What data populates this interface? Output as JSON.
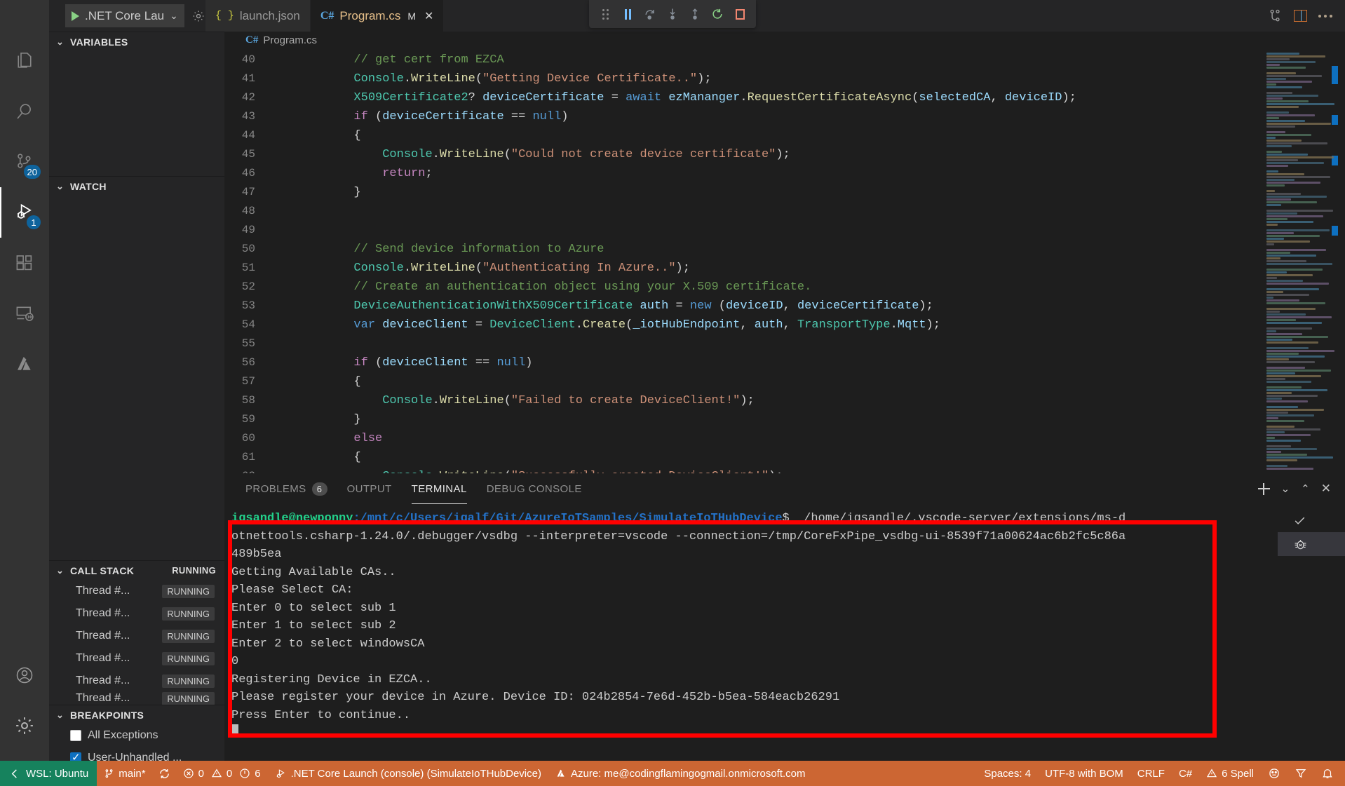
{
  "window": {
    "debug_config": ".NET Core Lau",
    "gear_icon": "gear-icon",
    "more_actions_icon": "ellipsis-icon"
  },
  "tabs": [
    {
      "label": "launch.json",
      "icon": "json-braces-icon",
      "active": false,
      "dirty": "",
      "closable": false
    },
    {
      "label": "Program.cs",
      "icon": "csharp-icon",
      "active": true,
      "dirty": "M",
      "closable": true
    }
  ],
  "debug_toolbar": {
    "buttons": [
      {
        "name": "drag-handle",
        "label": "Drag"
      },
      {
        "name": "pause-button",
        "label": "Pause"
      },
      {
        "name": "step-over-button",
        "label": "Step Over"
      },
      {
        "name": "step-into-button",
        "label": "Step Into"
      },
      {
        "name": "step-out-button",
        "label": "Step Out"
      },
      {
        "name": "restart-button",
        "label": "Restart"
      },
      {
        "name": "stop-button",
        "label": "Stop"
      }
    ]
  },
  "activity_bar": {
    "items": [
      {
        "name": "explorer",
        "icon": "files-icon",
        "badge": "",
        "active": false
      },
      {
        "name": "search",
        "icon": "search-icon",
        "badge": "",
        "active": false
      },
      {
        "name": "source-control",
        "icon": "source-control-icon",
        "badge": "20",
        "active": false
      },
      {
        "name": "run-and-debug",
        "icon": "run-debug-icon",
        "badge": "1",
        "active": true
      },
      {
        "name": "extensions",
        "icon": "extensions-icon",
        "badge": "",
        "active": false
      },
      {
        "name": "remote-explorer",
        "icon": "remote-explorer-icon",
        "badge": "",
        "active": false
      },
      {
        "name": "azure",
        "icon": "azure-icon",
        "badge": "",
        "active": false
      }
    ],
    "bottom_items": [
      {
        "name": "accounts",
        "icon": "account-icon"
      },
      {
        "name": "manage",
        "icon": "gear-icon"
      }
    ]
  },
  "sidebar": {
    "sections": [
      {
        "name": "variables",
        "title": "VARIABLES",
        "expanded": true,
        "tag": ""
      },
      {
        "name": "watch",
        "title": "WATCH",
        "expanded": true,
        "tag": ""
      },
      {
        "name": "call-stack",
        "title": "CALL STACK",
        "expanded": true,
        "tag": "RUNNING"
      },
      {
        "name": "breakpoints",
        "title": "BREAKPOINTS",
        "expanded": true,
        "tag": ""
      }
    ],
    "call_stack": [
      {
        "label": "Thread #...",
        "state": "RUNNING"
      },
      {
        "label": "Thread #...",
        "state": "RUNNING"
      },
      {
        "label": "Thread #...",
        "state": "RUNNING"
      },
      {
        "label": "Thread #...",
        "state": "RUNNING"
      },
      {
        "label": "Thread #...",
        "state": "RUNNING"
      },
      {
        "label": "Thread #...",
        "state": "RUNNING"
      }
    ],
    "breakpoints": [
      {
        "label": "All Exceptions",
        "checked": false
      },
      {
        "label": "User-Unhandled ...",
        "checked": true
      }
    ]
  },
  "breadcrumb": {
    "icon": "csharp-icon",
    "label": "Program.cs"
  },
  "editor": {
    "lines": [
      {
        "num": "40",
        "segments": [
          {
            "t": "            // get cert from EZCA",
            "c": "c-com"
          }
        ]
      },
      {
        "num": "41",
        "segments": [
          {
            "t": "            ",
            "c": "c-pl"
          },
          {
            "t": "Console",
            "c": "c-cls"
          },
          {
            "t": ".",
            "c": "c-pl"
          },
          {
            "t": "WriteLine",
            "c": "c-fn"
          },
          {
            "t": "(",
            "c": "c-pl"
          },
          {
            "t": "\"Getting Device Certificate..\"",
            "c": "c-str"
          },
          {
            "t": ");",
            "c": "c-pl"
          }
        ]
      },
      {
        "num": "42",
        "segments": [
          {
            "t": "            ",
            "c": "c-pl"
          },
          {
            "t": "X509Certificate2",
            "c": "c-type"
          },
          {
            "t": "? ",
            "c": "c-pl"
          },
          {
            "t": "deviceCertificate",
            "c": "c-var"
          },
          {
            "t": " = ",
            "c": "c-pl"
          },
          {
            "t": "await",
            "c": "c-kwb"
          },
          {
            "t": " ",
            "c": "c-pl"
          },
          {
            "t": "ezMananger",
            "c": "c-var"
          },
          {
            "t": ".",
            "c": "c-pl"
          },
          {
            "t": "RequestCertificateAsync",
            "c": "c-fn"
          },
          {
            "t": "(",
            "c": "c-pl"
          },
          {
            "t": "selectedCA",
            "c": "c-var"
          },
          {
            "t": ", ",
            "c": "c-pl"
          },
          {
            "t": "deviceID",
            "c": "c-var"
          },
          {
            "t": ");",
            "c": "c-pl"
          }
        ]
      },
      {
        "num": "43",
        "segments": [
          {
            "t": "            ",
            "c": "c-pl"
          },
          {
            "t": "if",
            "c": "c-kw"
          },
          {
            "t": " (",
            "c": "c-pl"
          },
          {
            "t": "deviceCertificate",
            "c": "c-var"
          },
          {
            "t": " == ",
            "c": "c-pl"
          },
          {
            "t": "null",
            "c": "c-kwb"
          },
          {
            "t": ")",
            "c": "c-pl"
          }
        ]
      },
      {
        "num": "44",
        "segments": [
          {
            "t": "            {",
            "c": "c-pl"
          }
        ]
      },
      {
        "num": "45",
        "segments": [
          {
            "t": "                ",
            "c": "c-pl"
          },
          {
            "t": "Console",
            "c": "c-cls"
          },
          {
            "t": ".",
            "c": "c-pl"
          },
          {
            "t": "WriteLine",
            "c": "c-fn"
          },
          {
            "t": "(",
            "c": "c-pl"
          },
          {
            "t": "\"Could not create device certificate\"",
            "c": "c-str"
          },
          {
            "t": ");",
            "c": "c-pl"
          }
        ]
      },
      {
        "num": "46",
        "segments": [
          {
            "t": "                ",
            "c": "c-pl"
          },
          {
            "t": "return",
            "c": "c-kw"
          },
          {
            "t": ";",
            "c": "c-pl"
          }
        ]
      },
      {
        "num": "47",
        "segments": [
          {
            "t": "            }",
            "c": "c-pl"
          }
        ]
      },
      {
        "num": "48",
        "segments": [
          {
            "t": "",
            "c": "c-pl"
          }
        ]
      },
      {
        "num": "49",
        "segments": [
          {
            "t": "",
            "c": "c-pl"
          }
        ]
      },
      {
        "num": "50",
        "segments": [
          {
            "t": "            // Send device information to Azure",
            "c": "c-com"
          }
        ]
      },
      {
        "num": "51",
        "segments": [
          {
            "t": "            ",
            "c": "c-pl"
          },
          {
            "t": "Console",
            "c": "c-cls"
          },
          {
            "t": ".",
            "c": "c-pl"
          },
          {
            "t": "WriteLine",
            "c": "c-fn"
          },
          {
            "t": "(",
            "c": "c-pl"
          },
          {
            "t": "\"Authenticating In Azure..\"",
            "c": "c-str"
          },
          {
            "t": ");",
            "c": "c-pl"
          }
        ]
      },
      {
        "num": "52",
        "segments": [
          {
            "t": "            // Create an authentication object using your X.509 certificate.",
            "c": "c-com"
          }
        ]
      },
      {
        "num": "53",
        "segments": [
          {
            "t": "            ",
            "c": "c-pl"
          },
          {
            "t": "DeviceAuthenticationWithX509Certificate",
            "c": "c-type"
          },
          {
            "t": " ",
            "c": "c-pl"
          },
          {
            "t": "auth",
            "c": "c-var"
          },
          {
            "t": " = ",
            "c": "c-pl"
          },
          {
            "t": "new",
            "c": "c-kwb"
          },
          {
            "t": " (",
            "c": "c-pl"
          },
          {
            "t": "deviceID",
            "c": "c-var"
          },
          {
            "t": ", ",
            "c": "c-pl"
          },
          {
            "t": "deviceCertificate",
            "c": "c-var"
          },
          {
            "t": ");",
            "c": "c-pl"
          }
        ]
      },
      {
        "num": "54",
        "segments": [
          {
            "t": "            ",
            "c": "c-pl"
          },
          {
            "t": "var",
            "c": "c-kwb"
          },
          {
            "t": " ",
            "c": "c-pl"
          },
          {
            "t": "deviceClient",
            "c": "c-var"
          },
          {
            "t": " = ",
            "c": "c-pl"
          },
          {
            "t": "DeviceClient",
            "c": "c-cls"
          },
          {
            "t": ".",
            "c": "c-pl"
          },
          {
            "t": "Create",
            "c": "c-fn"
          },
          {
            "t": "(",
            "c": "c-pl"
          },
          {
            "t": "_iotHubEndpoint",
            "c": "c-var"
          },
          {
            "t": ", ",
            "c": "c-pl"
          },
          {
            "t": "auth",
            "c": "c-var"
          },
          {
            "t": ", ",
            "c": "c-pl"
          },
          {
            "t": "TransportType",
            "c": "c-cls"
          },
          {
            "t": ".",
            "c": "c-pl"
          },
          {
            "t": "Mqtt",
            "c": "c-var"
          },
          {
            "t": ");",
            "c": "c-pl"
          }
        ]
      },
      {
        "num": "55",
        "segments": [
          {
            "t": "",
            "c": "c-pl"
          }
        ]
      },
      {
        "num": "56",
        "segments": [
          {
            "t": "            ",
            "c": "c-pl"
          },
          {
            "t": "if",
            "c": "c-kw"
          },
          {
            "t": " (",
            "c": "c-pl"
          },
          {
            "t": "deviceClient",
            "c": "c-var"
          },
          {
            "t": " == ",
            "c": "c-pl"
          },
          {
            "t": "null",
            "c": "c-kwb"
          },
          {
            "t": ")",
            "c": "c-pl"
          }
        ]
      },
      {
        "num": "57",
        "segments": [
          {
            "t": "            {",
            "c": "c-pl"
          }
        ]
      },
      {
        "num": "58",
        "segments": [
          {
            "t": "                ",
            "c": "c-pl"
          },
          {
            "t": "Console",
            "c": "c-cls"
          },
          {
            "t": ".",
            "c": "c-pl"
          },
          {
            "t": "WriteLine",
            "c": "c-fn"
          },
          {
            "t": "(",
            "c": "c-pl"
          },
          {
            "t": "\"Failed to create DeviceClient!\"",
            "c": "c-str"
          },
          {
            "t": ");",
            "c": "c-pl"
          }
        ]
      },
      {
        "num": "59",
        "segments": [
          {
            "t": "            }",
            "c": "c-pl"
          }
        ]
      },
      {
        "num": "60",
        "segments": [
          {
            "t": "            ",
            "c": "c-pl"
          },
          {
            "t": "else",
            "c": "c-kw"
          }
        ]
      },
      {
        "num": "61",
        "segments": [
          {
            "t": "            {",
            "c": "c-pl"
          }
        ]
      },
      {
        "num": "62",
        "segments": [
          {
            "t": "                ",
            "c": "c-pl"
          },
          {
            "t": "Console",
            "c": "c-cls"
          },
          {
            "t": ".",
            "c": "c-pl"
          },
          {
            "t": "WriteLine",
            "c": "c-fn"
          },
          {
            "t": "(",
            "c": "c-pl"
          },
          {
            "t": "\"Successfully created DeviceClient!\"",
            "c": "c-str"
          },
          {
            "t": ");",
            "c": "c-pl"
          }
        ]
      }
    ]
  },
  "panel": {
    "tabs": [
      {
        "label": "PROBLEMS",
        "count": "6",
        "active": false
      },
      {
        "label": "OUTPUT",
        "count": "",
        "active": false
      },
      {
        "label": "TERMINAL",
        "count": "",
        "active": true
      },
      {
        "label": "DEBUG CONSOLE",
        "count": "",
        "active": false
      }
    ],
    "actions": [
      {
        "name": "new-terminal-button",
        "icon": "plus-icon"
      },
      {
        "name": "terminal-dropdown-button",
        "icon": "chevron-down-icon"
      },
      {
        "name": "maximize-panel-button",
        "icon": "chevron-up-icon"
      },
      {
        "name": "close-panel-button",
        "icon": "close-icon"
      }
    ],
    "terminal_list": [
      {
        "name": "terminal-bash",
        "icon": "check-icon",
        "selected": false
      },
      {
        "name": "terminal-debug",
        "icon": "bug-icon",
        "selected": true
      }
    ]
  },
  "terminal": {
    "prompt_user": "igsandle@newponny",
    "prompt_path": ":/mnt/c/Users/igalf/Git/AzureIoTSamples/SimulateIoTHubDevice",
    "prompt_dollar": "$",
    "command": "  /home/igsandle/.vscode-server/extensions/ms-d",
    "lines": [
      "otnettools.csharp-1.24.0/.debugger/vsdbg --interpreter=vscode --connection=/tmp/CoreFxPipe_vsdbg-ui-8539f71a00624ac6b2fc5c86a",
      "489b5ea",
      "Getting Available CAs..",
      "Please Select CA:",
      "Enter 0 to select sub 1",
      "Enter 1 to select sub 2",
      "Enter 2 to select windowsCA",
      "0",
      "Registering Device in EZCA..",
      "Please register your device in Azure. Device ID: 024b2854-7e6d-452b-b5ea-584eacb26291",
      "Press Enter to continue.."
    ]
  },
  "status_bar": {
    "remote": "WSL: Ubuntu",
    "branch": "main*",
    "errors": "0",
    "warnings": "0",
    "ports": "6",
    "launch": ".NET Core Launch (console) (SimulateIoTHubDevice)",
    "azure": "Azure: me@codingflamingogmail.onmicrosoft.com",
    "spaces": "Spaces: 4",
    "encoding": "UTF-8 with BOM",
    "eol": "CRLF",
    "language": "C#",
    "spell": "6 Spell",
    "right_icons": [
      "smiley-icon",
      "send-feedback-icon",
      "bell-icon"
    ]
  },
  "colors": {
    "accent_orange": "#cc6633",
    "remote_green": "#16825d",
    "highlight_red": "#ff0000",
    "badge_blue": "#0e639c"
  }
}
